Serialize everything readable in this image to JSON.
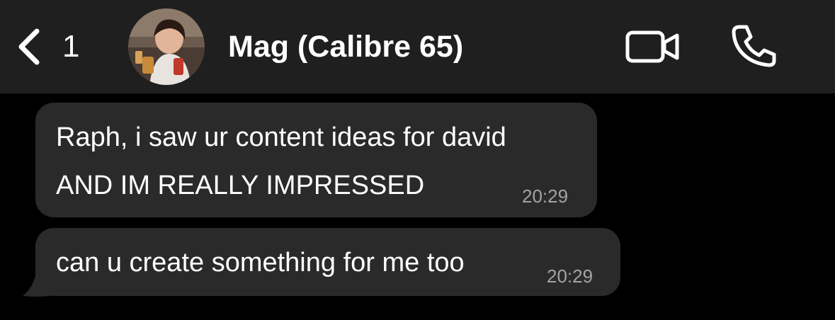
{
  "header": {
    "back_count": "1",
    "contact_name": "Mag (Calibre 65)",
    "icons": {
      "back": "chevron-left-icon",
      "avatar": "avatar",
      "video": "video-camera-icon",
      "call": "phone-icon"
    }
  },
  "messages": [
    {
      "lines": [
        "Raph, i saw ur content ideas for david",
        "AND IM REALLY IMPRESSED"
      ],
      "time": "20:29"
    },
    {
      "lines": [
        "can u create something for me too"
      ],
      "time": "20:29"
    }
  ],
  "colors": {
    "background": "#000000",
    "header": "#1f1f1f",
    "bubble": "#2a2a2a",
    "text": "#ffffff",
    "timestamp": "#a3a3a3"
  }
}
